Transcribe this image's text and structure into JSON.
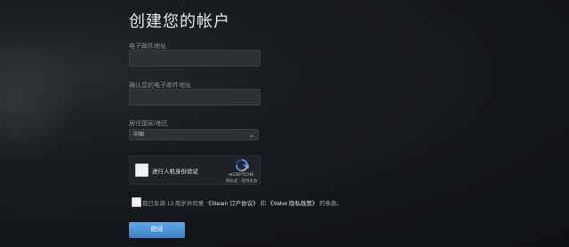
{
  "page": {
    "title": "创建您的帐户"
  },
  "form": {
    "email_label": "电子邮件地址",
    "email_value": "",
    "confirm_email_label": "确认您的电子邮件地址",
    "confirm_email_value": "",
    "country_label": "居住国家/地区",
    "country_selected": "中国"
  },
  "captcha": {
    "label": "进行人机身份验证",
    "brand": "reCAPTCHA",
    "privacy_link": "隐私权",
    "terms_link": "使用条款",
    "checked": false
  },
  "agreement": {
    "prefix": "我已年满 13 周岁并同意",
    "steam_agreement": "《Steam 订户协议》",
    "and": "和",
    "valve_privacy": "《Valve 隐私政策》",
    "suffix": "的条款。",
    "checked": false
  },
  "actions": {
    "continue_label": "继续"
  },
  "colors": {
    "background": "#141518",
    "input_background": "#2e3034",
    "button_gradient_top": "#63a9e6",
    "button_gradient_bottom": "#3c7fc2",
    "recaptcha_blue": "#4a8af4"
  }
}
